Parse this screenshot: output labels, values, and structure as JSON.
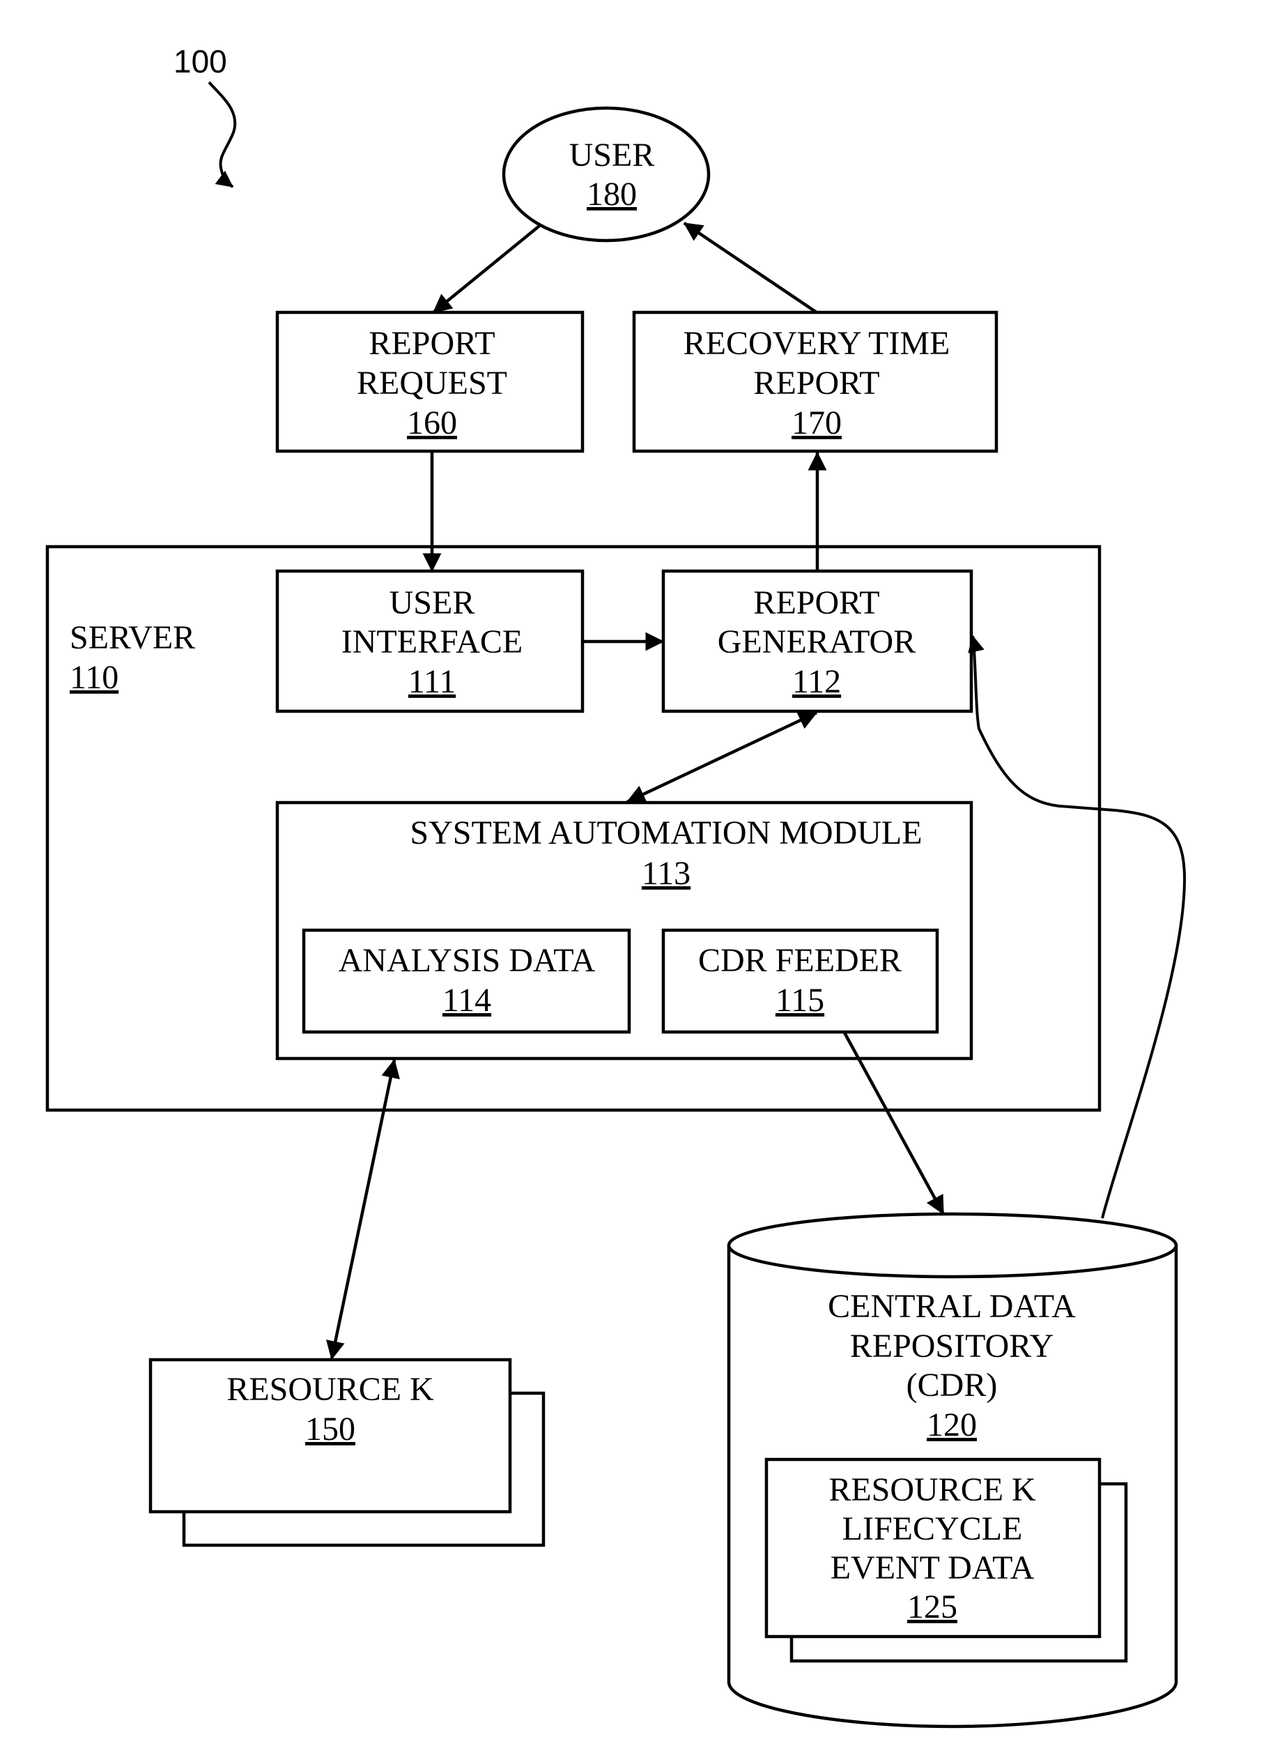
{
  "figure": {
    "label": "100"
  },
  "nodes": {
    "user": {
      "title": [
        "USER"
      ],
      "ref": "180"
    },
    "report_request": {
      "title": [
        "REPORT",
        "REQUEST"
      ],
      "ref": "160"
    },
    "recovery_time_report": {
      "title": [
        "RECOVERY TIME",
        "REPORT"
      ],
      "ref": "170"
    },
    "server": {
      "title": [
        "SERVER"
      ],
      "ref": "110"
    },
    "user_interface": {
      "title": [
        "USER",
        "INTERFACE"
      ],
      "ref": "111"
    },
    "report_generator": {
      "title": [
        "REPORT",
        "GENERATOR"
      ],
      "ref": "112"
    },
    "system_automation_module": {
      "title": [
        "SYSTEM AUTOMATION MODULE"
      ],
      "ref": "113"
    },
    "analysis_data": {
      "title": [
        "ANALYSIS DATA"
      ],
      "ref": "114"
    },
    "cdr_feeder": {
      "title": [
        "CDR FEEDER"
      ],
      "ref": "115"
    },
    "central_data_repository": {
      "title": [
        "CENTRAL DATA",
        "REPOSITORY",
        "(CDR)"
      ],
      "ref": "120"
    },
    "lifecycle_event_data": {
      "title": [
        "RESOURCE K",
        "LIFECYCLE",
        "EVENT DATA"
      ],
      "ref": "125"
    },
    "resource_k": {
      "title": [
        "RESOURCE K"
      ],
      "ref": "150"
    }
  },
  "edges": [
    {
      "from": "user",
      "to": "report_request",
      "direction": "forward"
    },
    {
      "from": "recovery_time_report",
      "to": "user",
      "direction": "forward"
    },
    {
      "from": "report_request",
      "to": "user_interface",
      "direction": "forward"
    },
    {
      "from": "report_generator",
      "to": "recovery_time_report",
      "direction": "forward"
    },
    {
      "from": "user_interface",
      "to": "report_generator",
      "direction": "forward"
    },
    {
      "from": "report_generator",
      "to": "system_automation_module",
      "direction": "bidirectional"
    },
    {
      "from": "system_automation_module",
      "to": "resource_k",
      "direction": "bidirectional"
    },
    {
      "from": "cdr_feeder",
      "to": "central_data_repository",
      "direction": "forward"
    },
    {
      "from": "central_data_repository",
      "to": "report_generator",
      "direction": "forward"
    }
  ]
}
